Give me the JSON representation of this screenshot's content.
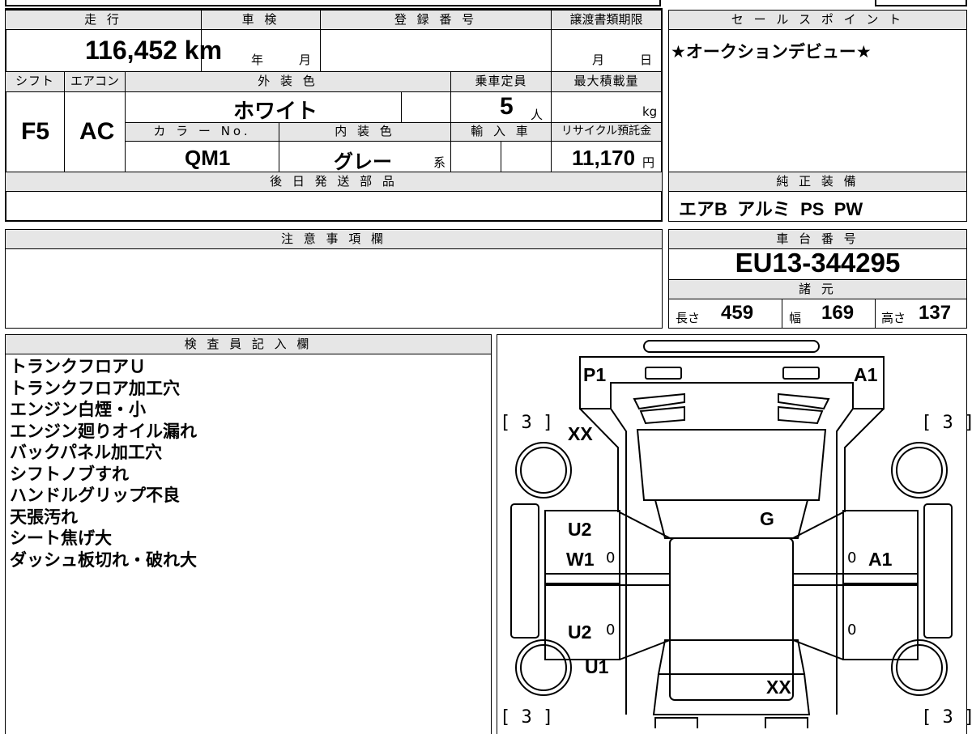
{
  "spec": {
    "headers": {
      "mileage": "走 行",
      "inspection": "車 検",
      "registration": "登 録 番 号",
      "transfer_deadline": "譲渡書類期限",
      "shift": "シフト",
      "aircon": "エアコン",
      "exterior_color": "外 装 色",
      "capacity": "乗車定員",
      "max_load": "最大積載量",
      "color_no": "カ ラ ー No.",
      "interior_color": "内 装 色",
      "import": "輸 入 車",
      "recycle_fee": "リサイクル預託金",
      "later_parts": "後 日 発 送 部 品"
    },
    "values": {
      "mileage": "116,452 km",
      "year_label": "年",
      "month_label": "月",
      "deadline_month": "月",
      "deadline_day": "日",
      "shift": "F5",
      "aircon": "AC",
      "exterior_color": "ホワイト",
      "capacity": "5",
      "capacity_unit": "人",
      "max_load_unit": "kg",
      "color_no": "QM1",
      "interior_color": "グレー",
      "interior_suffix": "系",
      "recycle_fee": "11,170",
      "recycle_unit": "円"
    }
  },
  "sales_point": {
    "header": "セ ー ル ス ポ イ ン ト",
    "text": "★オークションデビュー★"
  },
  "equipment": {
    "header": "純 正 装 備",
    "text": "エアB  アルミ  PS  PW"
  },
  "notes": {
    "header": "注 意 事 項 欄"
  },
  "chassis": {
    "header": "車 台 番 号",
    "number": "EU13-344295",
    "specs_header": "諸 元",
    "length_label": "長さ",
    "length": "459",
    "width_label": "幅",
    "width": "169",
    "height_label": "高さ",
    "height": "137"
  },
  "inspector": {
    "header": "検 査 員 記 入 欄",
    "items": [
      "トランクフロアＵ",
      "トランクフロア加工穴",
      "エンジン白煙・小",
      "エンジン廻りオイル漏れ",
      "バックパネル加工穴",
      "シフトノブすれ",
      "ハンドルグリップ不良",
      "天張汚れ",
      "シート焦げ大",
      "ダッシュ板切れ・破れ大"
    ]
  },
  "diagram": {
    "marks": {
      "rear_left": "P1",
      "rear_right": "A1",
      "tire_rl": "[ 3 ]",
      "tire_rr": "[ 3 ]",
      "tire_fl": "[ 3 ]",
      "tire_fr": "[ 3 ]",
      "rear_quarter_left": "XX",
      "roof": "G",
      "rear_door_left_1": "U2",
      "rear_door_left_2": "W1",
      "front_door_left": "U2",
      "front_fender_left": "U1",
      "rear_door_right": "A1",
      "hood": "XX",
      "zero": "0"
    }
  }
}
